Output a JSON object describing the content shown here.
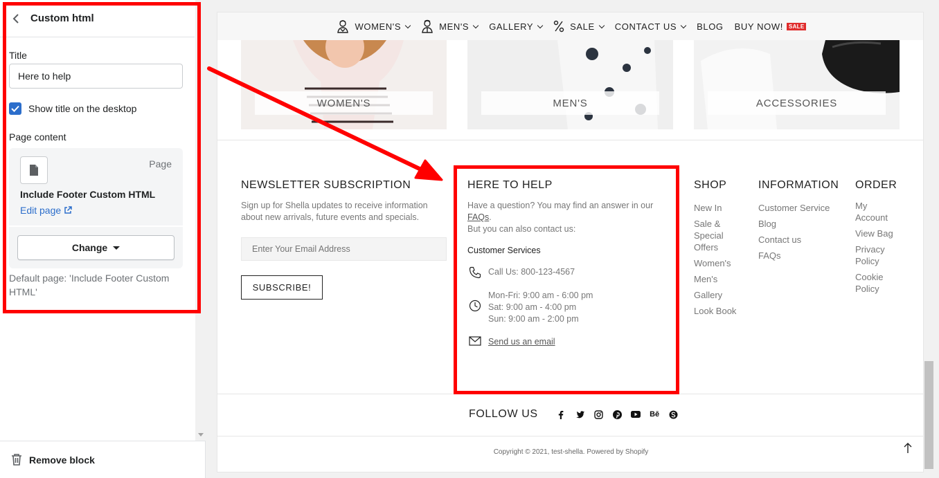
{
  "editor": {
    "header_title": "Custom html",
    "title_label": "Title",
    "title_value": "Here to help",
    "show_title_label": "Show title on the desktop",
    "show_title_checked": true,
    "page_content_label": "Page content",
    "page_type": "Page",
    "page_name": "Include Footer Custom HTML",
    "edit_page_label": "Edit page",
    "change_label": "Change",
    "default_page_text": "Default page: 'Include Footer Custom HTML'",
    "remove_block_label": "Remove block",
    "accent_color": "#2c6ecb"
  },
  "annotation": {
    "highlight_color": "#ff0000"
  },
  "store": {
    "nav": [
      {
        "label": "WOMEN'S",
        "icon": "woman-icon",
        "dropdown": true
      },
      {
        "label": "MEN'S",
        "icon": "man-icon",
        "dropdown": true
      },
      {
        "label": "GALLERY",
        "icon": "",
        "dropdown": true
      },
      {
        "label": "SALE",
        "icon": "percent-icon",
        "dropdown": true
      },
      {
        "label": "CONTACT US",
        "icon": "",
        "dropdown": true
      },
      {
        "label": "BLOG",
        "icon": "",
        "dropdown": false
      },
      {
        "label": "BUY NOW!",
        "icon": "",
        "dropdown": false,
        "badge": "SALE"
      }
    ],
    "categories": [
      "WOMEN'S",
      "MEN'S",
      "ACCESSORIES"
    ],
    "newsletter": {
      "title": "NEWSLETTER SUBSCRIPTION",
      "text": "Sign up for Shella updates to receive information about new arrivals, future events and specials.",
      "email_placeholder": "Enter Your Email Address",
      "button_label": "SUBSCRIBE!"
    },
    "help": {
      "title": "HERE TO HELP",
      "intro_1": "Have a question? You may find an answer in our",
      "faq_link": "FAQs",
      "intro_2": "But you can also contact us:",
      "section_label": "Customer Services",
      "phone": "Call Us: 800-123-4567",
      "hours": [
        "Mon-Fri: 9:00 am - 6:00 pm",
        "Sat: 9:00 am - 4:00 pm",
        "Sun: 9:00 am - 2:00 pm"
      ],
      "email_link": "Send us an email"
    },
    "shop": {
      "title": "SHOP",
      "links": [
        "New In",
        "Sale & Special Offers",
        "Women's",
        "Men's",
        "Gallery",
        "Look Book"
      ]
    },
    "information": {
      "title": "INFORMATION",
      "links": [
        "Customer Service",
        "Blog",
        "Contact us",
        "FAQs"
      ]
    },
    "order": {
      "title": "ORDER",
      "links": [
        "My Account",
        "View Bag",
        "Privacy Policy",
        "Cookie Policy"
      ]
    },
    "follow_title": "FOLLOW US",
    "social": [
      "facebook-icon",
      "twitter-icon",
      "instagram-icon",
      "pinterest-icon",
      "youtube-icon",
      "behance-icon",
      "skype-icon"
    ],
    "behance_text": "Bē",
    "copyright": "Copyright © 2021, test-shella. Powered by Shopify",
    "sale_color": "#e02d2d"
  }
}
